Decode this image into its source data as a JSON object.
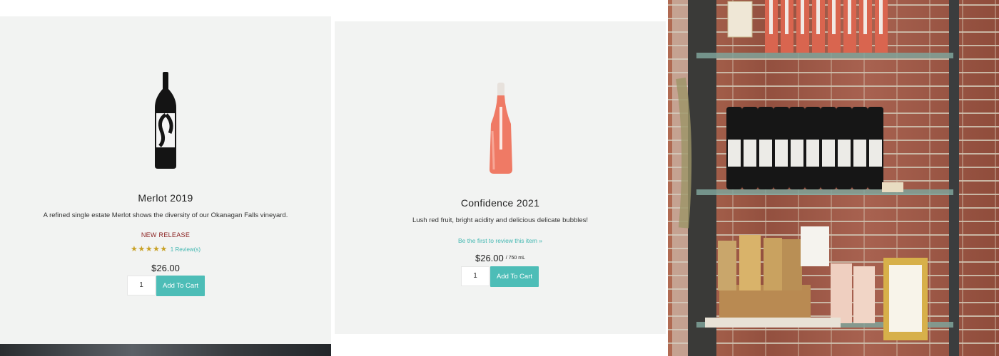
{
  "products": [
    {
      "name": "Merlot 2019",
      "description": "A refined single estate Merlot shows the diversity of our Okanagan Falls vineyard.",
      "badge": "NEW RELEASE",
      "rating_stars": "★★★★★",
      "rating": 5,
      "reviews_label": "1 Review(s)",
      "price": "$26.00",
      "quantity": "1",
      "add_to_cart_label": "Add To Cart"
    },
    {
      "name": "Confidence 2021",
      "description": "Lush red fruit, bright acidity and delicious delicate bubbles!",
      "review_prompt": "Be the first to review this item »",
      "price": "$26.00",
      "unit": "/ 750 mL",
      "quantity": "1",
      "add_to_cart_label": "Add To Cart"
    }
  ],
  "colors": {
    "card_bg": "#f2f3f2",
    "accent": "#4dbdb7",
    "badge": "#8a1f1f",
    "stars": "#c9a227"
  }
}
